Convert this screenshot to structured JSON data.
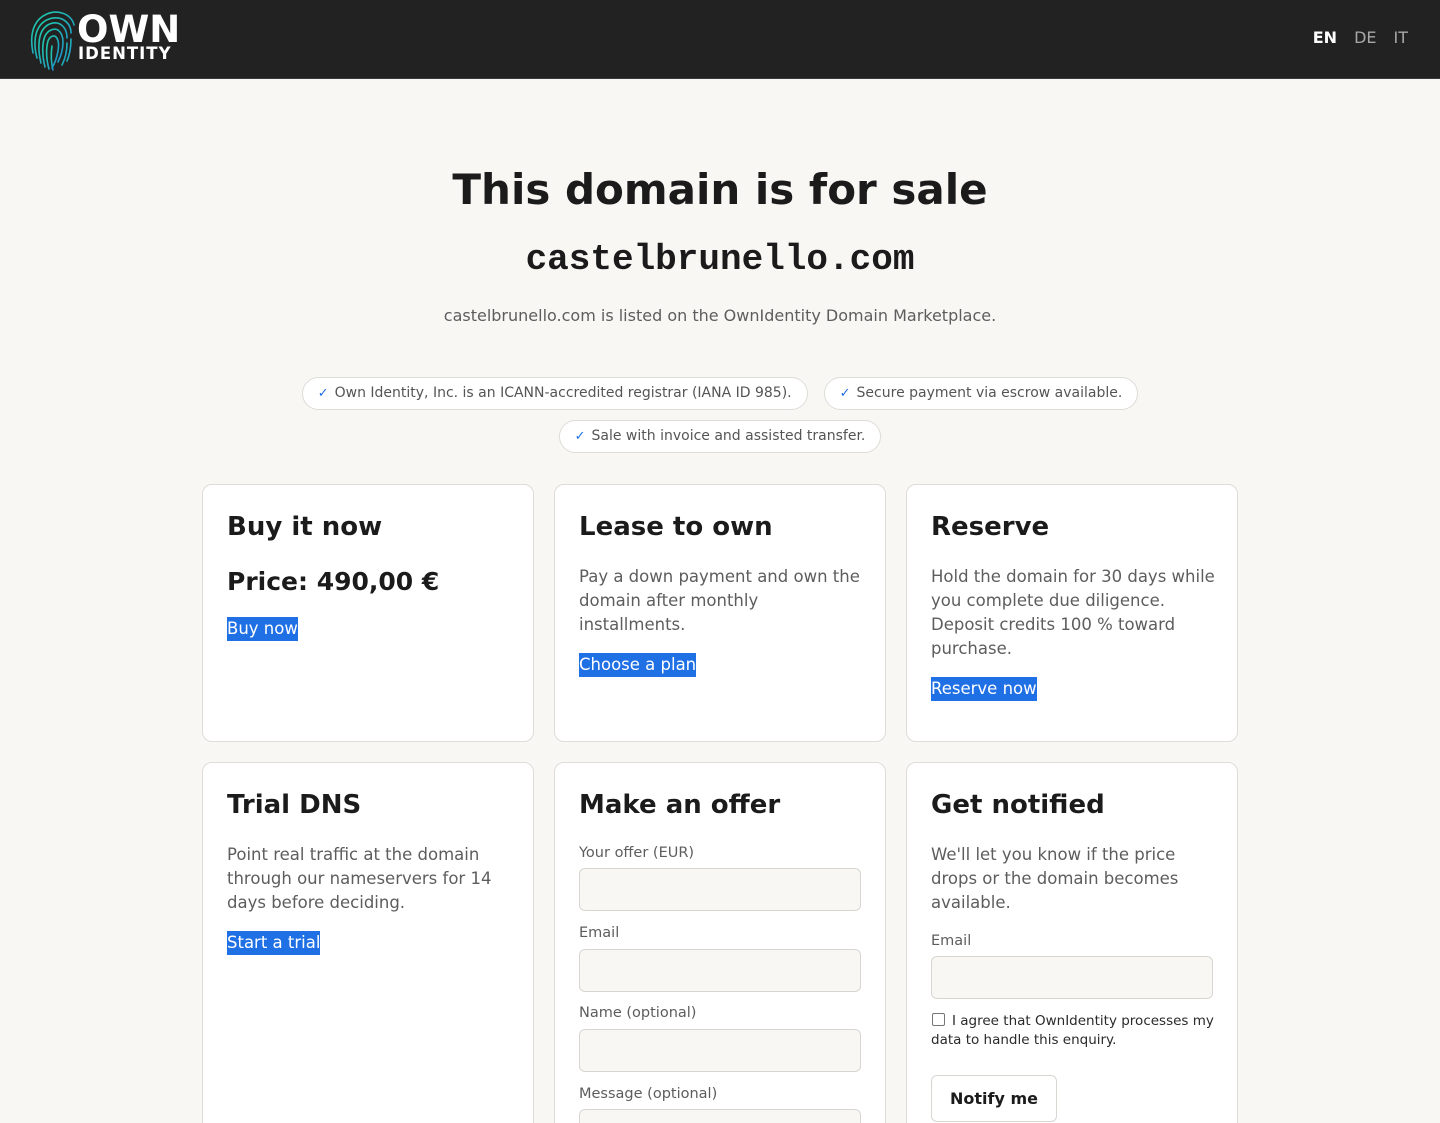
{
  "header": {
    "logo": {
      "line1": "OWN",
      "line2": "IDENTITY"
    },
    "languages": [
      {
        "code": "EN",
        "active": true
      },
      {
        "code": "DE",
        "active": false
      },
      {
        "code": "IT",
        "active": false
      }
    ]
  },
  "hero": {
    "title": "This domain is for sale",
    "domain": "castelbrunello.com",
    "subtitle": "castelbrunello.com is listed on the OwnIdentity Domain Marketplace."
  },
  "badges": [
    "Own Identity, Inc. is an ICANN-accredited registrar (IANA ID 985).",
    "Secure payment via escrow available.",
    "Sale with invoice and assisted transfer."
  ],
  "cards": {
    "buy": {
      "title": "Buy it now",
      "price": "Price: 490,00 €",
      "button": "Buy now"
    },
    "lease": {
      "title": "Lease to own",
      "text": "Pay a down payment and own the domain after monthly installments.",
      "button": "Choose a plan"
    },
    "reserve": {
      "title": "Reserve",
      "text": "Hold the domain for 30 days while you complete due diligence. Deposit credits 100 % toward purchase.",
      "button": "Reserve now"
    },
    "trial": {
      "title": "Trial DNS",
      "text": "Point real traffic at the domain through our nameservers for 14 days before deciding.",
      "button": "Start a trial"
    },
    "offer": {
      "title": "Make an offer",
      "fields": {
        "offer_label": "Your offer (EUR)",
        "offer_value": "",
        "email_label": "Email",
        "email_value": "",
        "name_label": "Name (optional)",
        "name_value": "",
        "message_label": "Message (optional)",
        "message_value": ""
      }
    },
    "notify": {
      "title": "Get notified",
      "text": "We'll let you know if the price drops or the domain becomes available.",
      "email_label": "Email",
      "email_value": "",
      "consent": "I agree that OwnIdentity processes my data to handle this enquiry.",
      "consent_checked": false,
      "button": "Notify me"
    }
  },
  "colors": {
    "header_bg": "#222222",
    "page_bg": "#f8f7f4",
    "accent": "#1f6fe5",
    "logo_gradient": [
      "#1fd0a8",
      "#1f6fe5"
    ]
  }
}
